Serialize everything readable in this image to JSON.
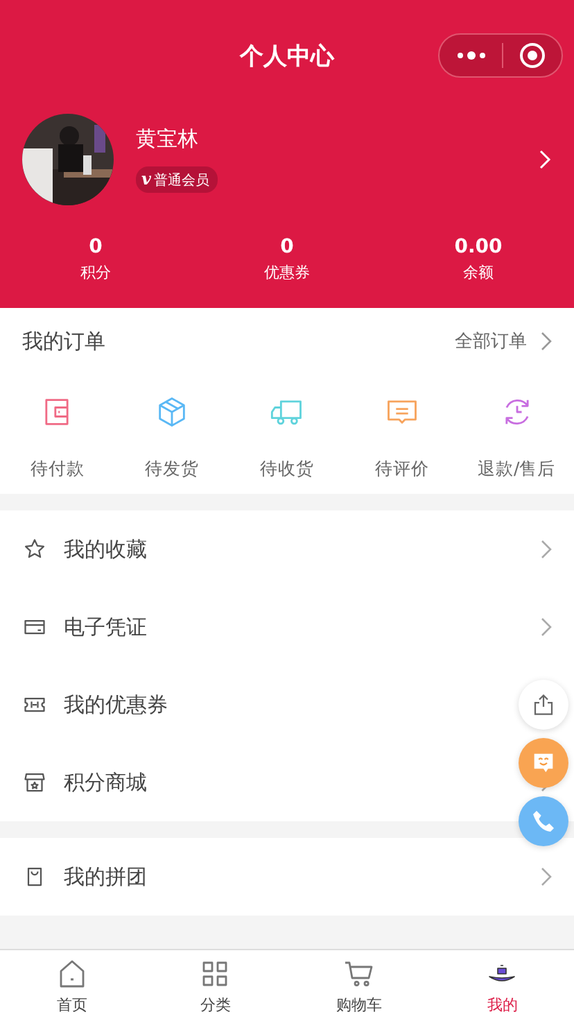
{
  "nav": {
    "title": "个人中心"
  },
  "profile": {
    "name": "黄宝林",
    "badge_mark": "v",
    "badge": "普通会员"
  },
  "stats": [
    {
      "value": "0",
      "label": "积分"
    },
    {
      "value": "0",
      "label": "优惠券"
    },
    {
      "value": "0.00",
      "label": "余额"
    }
  ],
  "orders": {
    "title": "我的订单",
    "link": "全部订单",
    "items": [
      {
        "kind": "wallet",
        "label": "待付款",
        "color": "#f06a85"
      },
      {
        "kind": "box",
        "label": "待发货",
        "color": "#5ab8f5"
      },
      {
        "kind": "truck",
        "label": "待收货",
        "color": "#5fd3dc"
      },
      {
        "kind": "comment",
        "label": "待评价",
        "color": "#f7a35c"
      },
      {
        "kind": "refund",
        "label": "退款/售后",
        "color": "#c86ee0"
      }
    ]
  },
  "menu_groups": [
    [
      {
        "kind": "star",
        "label": "我的收藏",
        "chevron": true
      },
      {
        "kind": "card",
        "label": "电子凭证",
        "chevron": true
      },
      {
        "kind": "coupon",
        "label": "我的优惠券",
        "chevron": false
      },
      {
        "kind": "shop",
        "label": "积分商城",
        "chevron": true
      }
    ],
    [
      {
        "kind": "bag",
        "label": "我的拼团",
        "chevron": true
      }
    ]
  ],
  "tabs": [
    {
      "kind": "home",
      "label": "首页",
      "selected": false
    },
    {
      "kind": "grid",
      "label": "分类",
      "selected": false
    },
    {
      "kind": "cart",
      "label": "购物车",
      "selected": false
    },
    {
      "kind": "me",
      "label": "我的",
      "selected": true
    }
  ]
}
